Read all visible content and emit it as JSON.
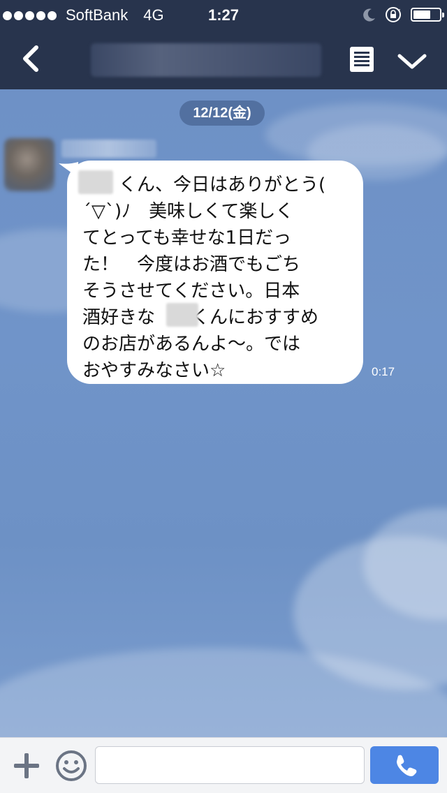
{
  "status_bar": {
    "carrier": "SoftBank",
    "network": "4G",
    "time": "1:27",
    "signal_icon": "signal-dots-icon",
    "moon_icon": "moon-icon",
    "rotation_lock_icon": "rotation-lock-icon",
    "battery_icon": "battery-icon",
    "battery_level": 0.6
  },
  "nav": {
    "back_icon": "chevron-left-icon",
    "menu_icon": "list-menu-icon",
    "expand_icon": "chevron-down-icon"
  },
  "chat": {
    "date_label": "12/12(金)",
    "messages": [
      {
        "sender": "incoming",
        "lines": [
          "　　くん、今日はありがとう(",
          "´▽`)ﾉ　美味しくて楽しく",
          "てとっても幸せな1日だっ",
          "た！　今度はお酒でもごち",
          "そうさせてください。日本",
          "酒好きな　　くんにおすすめ",
          "のお店があるんよ〜。では",
          "おやすみなさい☆"
        ],
        "time": "0:17"
      }
    ]
  },
  "input_bar": {
    "plus_icon": "plus-icon",
    "emoji_icon": "smiley-icon",
    "placeholder": "",
    "call_icon": "phone-icon"
  },
  "colors": {
    "bar_bg": "#28344d",
    "chat_bg": "#6f93c7",
    "call_button": "#4d86e4"
  }
}
